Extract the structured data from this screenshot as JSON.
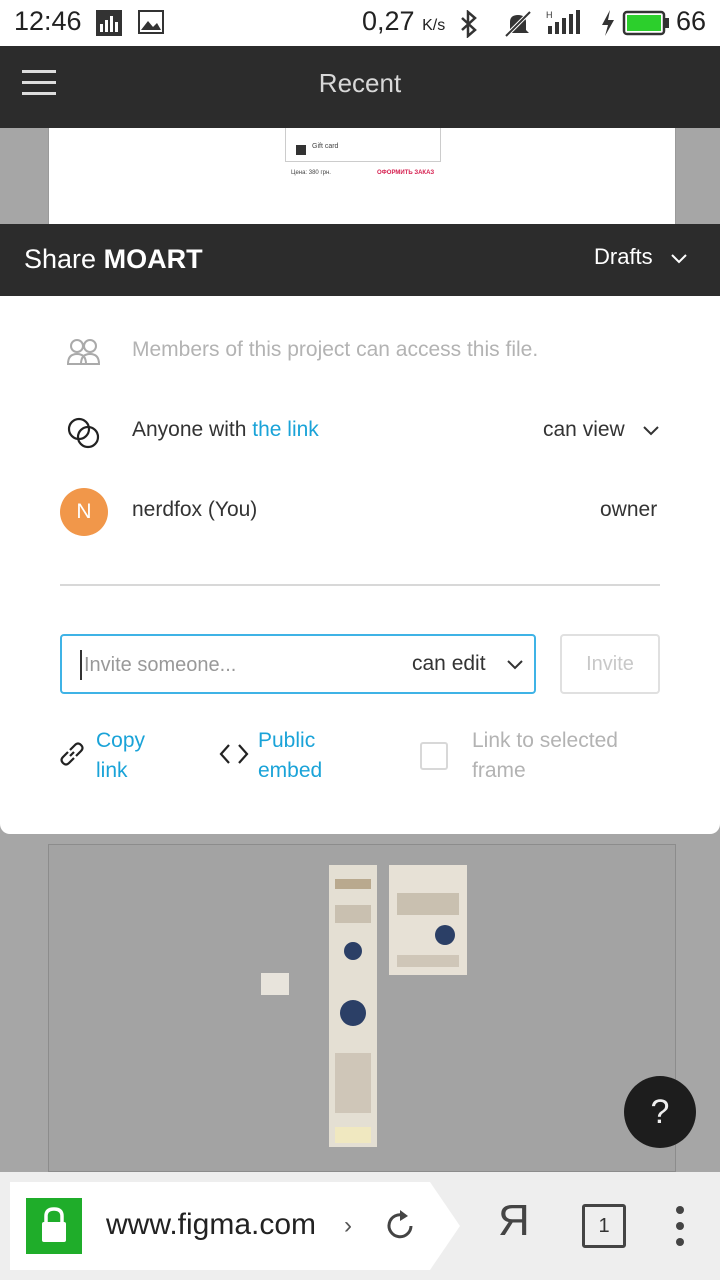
{
  "status_bar": {
    "time": "12:46",
    "speed": "0,27",
    "speed_unit": "K/s",
    "battery_level": "66",
    "icons": [
      "equalizer-icon",
      "image-icon",
      "bluetooth-icon",
      "mute-icon",
      "signal-icon",
      "charging-icon",
      "battery-icon"
    ]
  },
  "app_bar": {
    "title": "Recent"
  },
  "background": {
    "gift_card_label": "Gift card",
    "price_label": "Цена: 380 грн.",
    "order_label": "ОФОРМИТЬ ЗАКАЗ"
  },
  "share": {
    "title_prefix": "Share",
    "file_name": "MOART",
    "location": "Drafts",
    "members_text": "Members of this project can access this file.",
    "anyone_prefix": "Anyone with",
    "anyone_link": "the link",
    "anyone_permission": "can view",
    "user_initial": "N",
    "user_name": "nerdfox (You)",
    "user_role": "owner",
    "invite_placeholder": "Invite someone...",
    "invite_permission": "can edit",
    "invite_button": "Invite",
    "copy_link_1": "Copy",
    "copy_link_2": "link",
    "embed_1": "Public",
    "embed_2": "embed",
    "selected_frame_1": "Link to selected",
    "selected_frame_2": "frame"
  },
  "help_label": "?",
  "browser": {
    "url": "www.figma.com",
    "url_chevron": "›",
    "ya": "Я",
    "tab_count": "1"
  },
  "colors": {
    "accent": "#1aa3d8",
    "avatar": "#f1974a",
    "header": "#2c2c2c",
    "lock": "#1fad2a",
    "battery": "#2ccf2c"
  }
}
